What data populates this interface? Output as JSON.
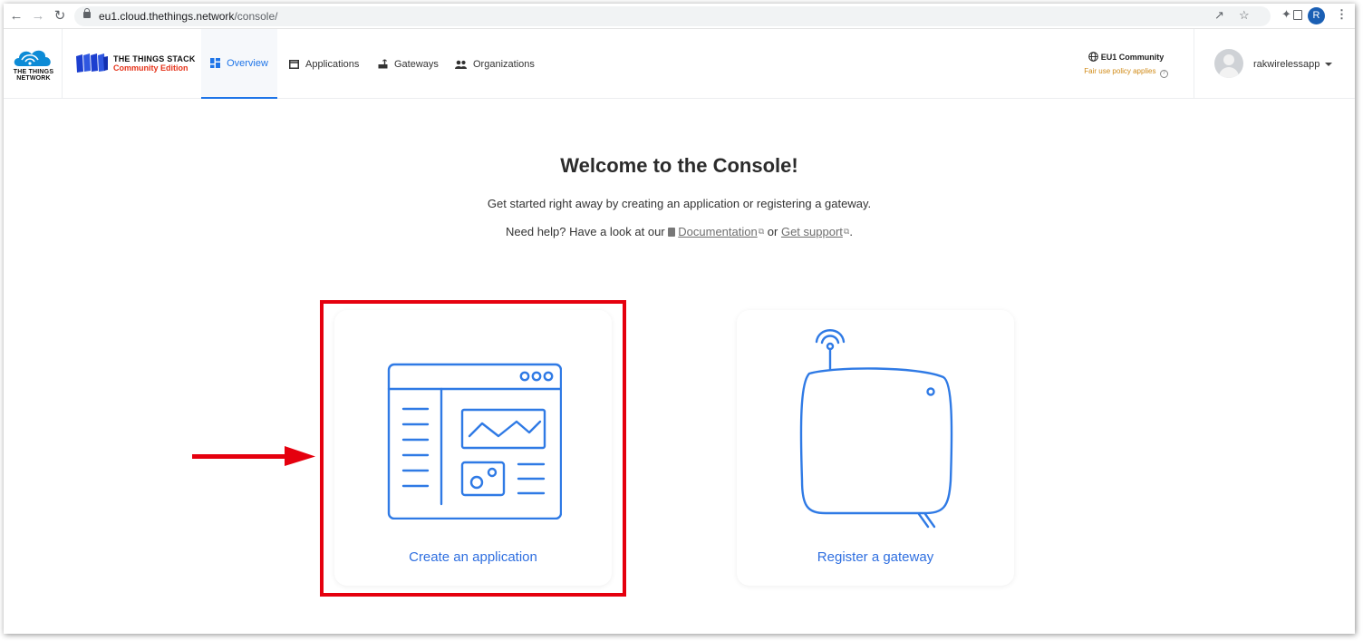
{
  "browser": {
    "url_host": "eu1.cloud.thethings.network",
    "url_path": "/console/",
    "profile_initial": "R"
  },
  "header": {
    "ttn_logo_text": "THE THINGS NETWORK",
    "stack_title": "THE THINGS STACK",
    "stack_subtitle": "Community Edition",
    "nav": [
      {
        "label": "Overview",
        "icon": "dashboard-icon",
        "active": true
      },
      {
        "label": "Applications",
        "icon": "window-icon",
        "active": false
      },
      {
        "label": "Gateways",
        "icon": "router-icon",
        "active": false
      },
      {
        "label": "Organizations",
        "icon": "people-icon",
        "active": false
      }
    ],
    "region": {
      "name": "EU1 Community",
      "note": "Fair use policy applies"
    },
    "user": {
      "name": "rakwirelessapp"
    }
  },
  "main": {
    "title": "Welcome to the Console!",
    "subtitle": "Get started right away by creating an application or registering a gateway.",
    "help_prefix": "Need help? Have a look at our",
    "help_doc_link": "Documentation",
    "help_or": "or",
    "help_support_link": "Get support",
    "help_suffix": ".",
    "cards": [
      {
        "label": "Create an application",
        "icon": "application-window-icon"
      },
      {
        "label": "Register a gateway",
        "icon": "gateway-device-icon"
      }
    ]
  },
  "colors": {
    "accent": "#1f75e8",
    "highlight": "#e5000e",
    "warning_text": "#d08a16",
    "brand_red": "#e5331a"
  }
}
